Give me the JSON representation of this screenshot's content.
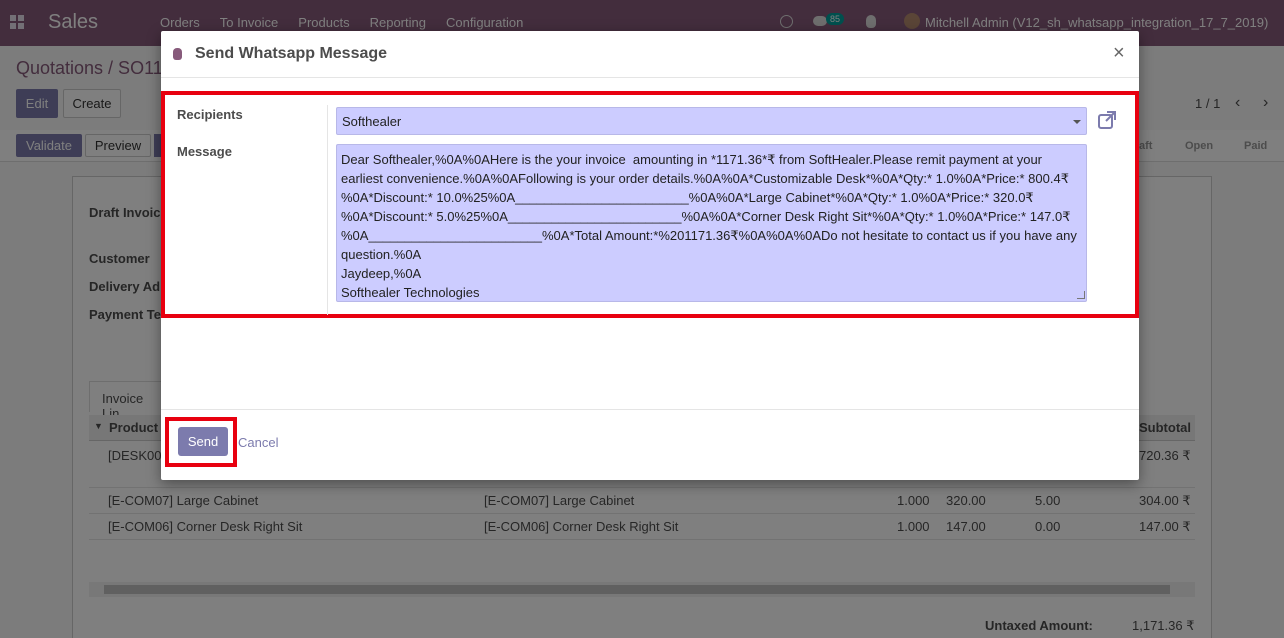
{
  "navbar": {
    "app_name": "Sales",
    "menu": [
      "Orders",
      "To Invoice",
      "Products",
      "Reporting",
      "Configuration"
    ],
    "chat_count": "85",
    "user": "Mitchell Admin (V12_sh_whatsapp_integration_17_7_2019)"
  },
  "control_panel": {
    "breadcrumb": "Quotations / SO11",
    "edit_label": "Edit",
    "create_label": "Create",
    "pager": "1 / 1"
  },
  "statusbar": {
    "validate_label": "Validate",
    "preview_label": "Preview",
    "stages": [
      "aft",
      "Open",
      "Paid"
    ]
  },
  "sheet": {
    "labels": [
      "Draft Invoic",
      "Customer",
      "Delivery Ad",
      "Payment Te"
    ],
    "tab_label": "Invoice Lin",
    "table_header": {
      "product": "Product",
      "subtotal": "Subtotal"
    },
    "rows": [
      {
        "product": "[DESK00",
        "description": "",
        "qty": "",
        "price": "",
        "discount": "",
        "subtotal": "720.36 ₹"
      },
      {
        "product": "[E-COM07] Large Cabinet",
        "description": "[E-COM07] Large Cabinet",
        "qty": "1.000",
        "price": "320.00",
        "discount": "5.00",
        "subtotal": "304.00 ₹"
      },
      {
        "product": "[E-COM06] Corner Desk Right Sit",
        "description": "[E-COM06] Corner Desk Right Sit",
        "qty": "1.000",
        "price": "147.00",
        "discount": "0.00",
        "subtotal": "147.00 ₹"
      }
    ],
    "totals": {
      "label": "Untaxed Amount:",
      "value": "1,171.36 ₹"
    }
  },
  "modal": {
    "title": "Send Whatsapp Message",
    "close": "×",
    "recipients_label": "Recipients",
    "recipients_value": "Softhealer",
    "message_label": "Message",
    "message_value": "Dear Softhealer,%0A%0AHere is the your invoice  amounting in *1171.36*₹ from SoftHealer.Please remit payment at your earliest convenience.%0A%0AFollowing is your order details.%0A%0A*Customizable Desk*%0A*Qty:* 1.0%0A*Price:* 800.4₹%0A*Discount:* 10.0%25%0A________________________%0A%0A*Large Cabinet*%0A*Qty:* 1.0%0A*Price:* 320.0₹%0A*Discount:* 5.0%25%0A________________________%0A%0A*Corner Desk Right Sit*%0A*Qty:* 1.0%0A*Price:* 147.0₹%0A________________________%0A*Total Amount:*%201171.36₹%0A%0A%0ADo not hesitate to contact us if you have any question.%0A\nJaydeep,%0A\nSofthealer Technologies",
    "send_label": "Send",
    "cancel_label": "Cancel"
  },
  "colors": {
    "navbar": "#875a7b",
    "primary_button": "#7c7bad",
    "highlight_box": "#e8000f",
    "field_background": "#ccccff"
  }
}
